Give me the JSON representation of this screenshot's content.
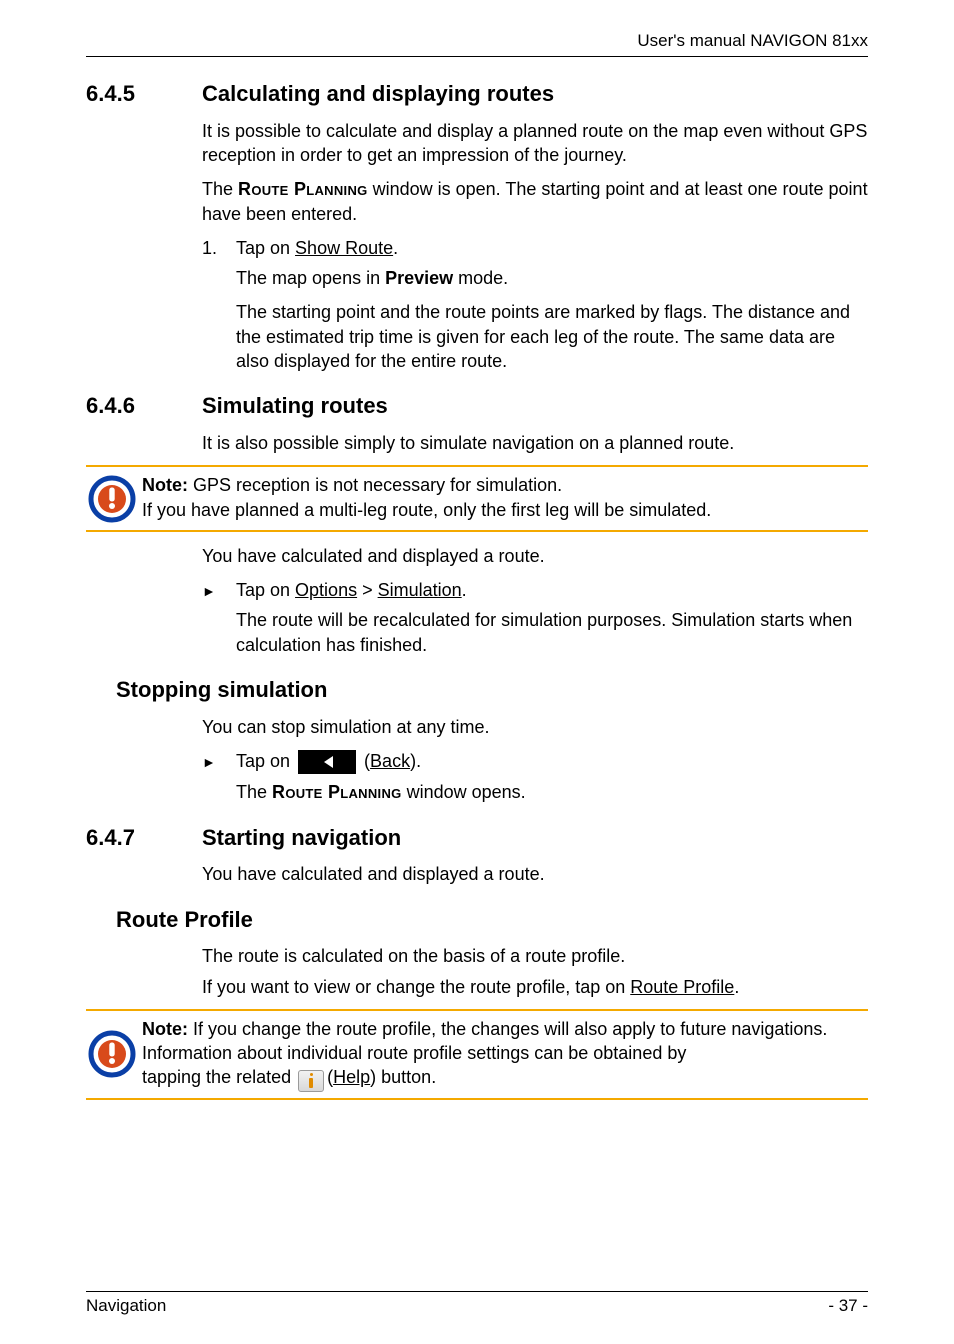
{
  "header": {
    "right": "User's manual NAVIGON 81xx"
  },
  "footer": {
    "left": "Navigation",
    "right": "- 37 -"
  },
  "s645": {
    "num": "6.4.5",
    "title": "Calculating and displaying routes",
    "p1": "It is possible to calculate and display a planned route on the map even without GPS reception in order to get an impression of the journey.",
    "p2_a": "The ",
    "p2_b": "Route Planning",
    "p2_c": " window is open. The starting point and at least one route point have been entered.",
    "step1_num": "1.",
    "step1_a": "Tap on ",
    "step1_b": "Show Route",
    "step1_c": ".",
    "step1_r1_a": "The map opens in ",
    "step1_r1_b": "Preview",
    "step1_r1_c": " mode.",
    "step1_r2": "The starting point and the route points are marked by flags. The distance and the estimated trip time is given for each leg of the route. The same data are also displayed for the entire route."
  },
  "s646": {
    "num": "6.4.6",
    "title": "Simulating routes",
    "p1": "It is also possible simply to simulate navigation on a planned route.",
    "note_a": "Note:",
    "note_b": " GPS reception is not necessary for simulation.",
    "note_c": "If you have planned a multi-leg route, only the first leg will be simulated.",
    "p2": "You have calculated and displayed a route.",
    "b1_a": "Tap on ",
    "b1_b": "Options",
    "b1_c": " > ",
    "b1_d": "Simulation",
    "b1_e": ".",
    "b1_r": "The route will be recalculated for simulation purposes. Simulation starts when calculation has finished.",
    "stop_title": "Stopping simulation",
    "stop_p1": "You can stop simulation at any time.",
    "stop_b_a": "Tap on ",
    "stop_b_b": "Back",
    "stop_b_c": ").",
    "stop_b_open": " (",
    "stop_r_a": "The ",
    "stop_r_b": "Route Planning",
    "stop_r_c": " window opens."
  },
  "s647": {
    "num": "6.4.7",
    "title": "Starting navigation",
    "p1": "You have calculated and displayed a route.",
    "rp_title": "Route Profile",
    "rp_p1": "The route is calculated on the basis of a route profile.",
    "rp_p2_a": "If you want to view or change the route profile, tap on ",
    "rp_p2_b": "Route Profile",
    "rp_p2_c": ".",
    "note_a": "Note:",
    "note_b": " If you change the route profile, the changes will also apply to future navigations.",
    "note_c": "Information about individual route profile settings can be obtained by",
    "note_d_a": "tapping the related ",
    "note_d_b": " (",
    "note_d_c": "Help",
    "note_d_d": ") button."
  }
}
